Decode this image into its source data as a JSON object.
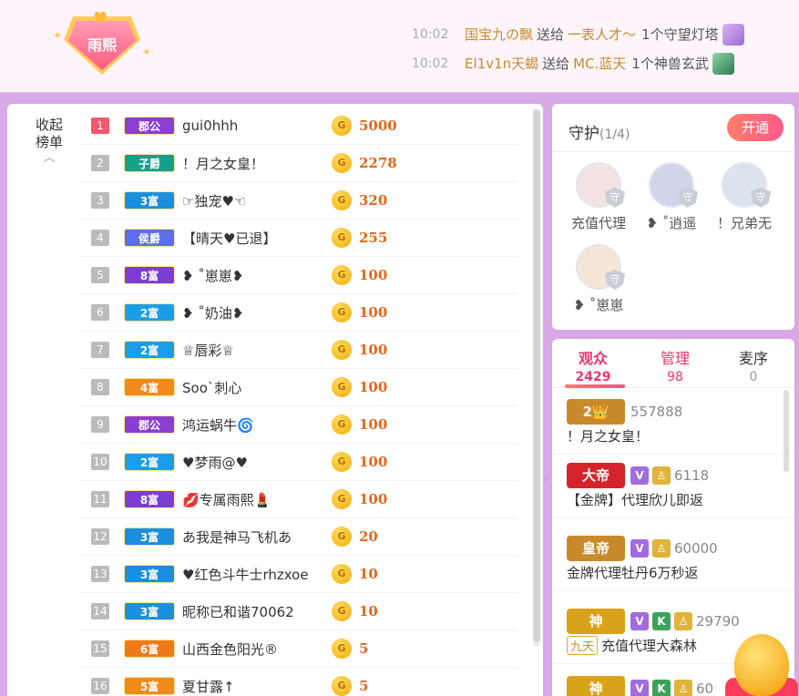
{
  "header": {
    "badge_label": "雨熙",
    "ticker": [
      {
        "time": "10:02",
        "sender": "国宝九の飘",
        "verb": "送给",
        "receiver": "一表人才～",
        "gift": "1个守望灯塔"
      },
      {
        "time": "10:02",
        "sender": "El1v1n天蝎",
        "verb": "送给",
        "receiver": "MC.蓝天",
        "gift": "1个神兽玄武"
      }
    ]
  },
  "ranking": {
    "collapse_label_1": "收起",
    "collapse_label_2": "榜单",
    "rows": [
      {
        "rank": "1",
        "level": "郡公",
        "level_color": "#8a3fd1",
        "name": "gui0hhh",
        "score": "5000"
      },
      {
        "rank": "2",
        "level": "子爵",
        "level_color": "#16a089",
        "name": "！月之女皇！",
        "score": "2278"
      },
      {
        "rank": "3",
        "level": "3富",
        "level_color": "#1a8fe0",
        "name": "☞独宠♥☜",
        "score": "320"
      },
      {
        "rank": "4",
        "level": "侯爵",
        "level_color": "#5a6fe8",
        "name": "【晴天♥已退】",
        "score": "255"
      },
      {
        "rank": "5",
        "level": "8富",
        "level_color": "#7c3cd8",
        "name": "❥ ˚崽崽❥",
        "score": "100"
      },
      {
        "rank": "6",
        "level": "2富",
        "level_color": "#1a9ee8",
        "name": "❥ ˚奶油❥",
        "score": "100"
      },
      {
        "rank": "7",
        "level": "2富",
        "level_color": "#1a9ee8",
        "name": "♕唇彩♕",
        "score": "100"
      },
      {
        "rank": "8",
        "level": "4富",
        "level_color": "#f08a1a",
        "name": "Soo`刺心",
        "score": "100"
      },
      {
        "rank": "9",
        "level": "郡公",
        "level_color": "#8a3fd1",
        "name": "鸿运蜗牛🌀",
        "score": "100"
      },
      {
        "rank": "10",
        "level": "2富",
        "level_color": "#1a9ee8",
        "name": "♥梦雨@♥",
        "score": "100"
      },
      {
        "rank": "11",
        "level": "8富",
        "level_color": "#7c3cd8",
        "name": "💋专属雨熙💄",
        "score": "100"
      },
      {
        "rank": "12",
        "level": "3富",
        "level_color": "#1a8fe0",
        "name": "あ我是神马飞机あ",
        "score": "20"
      },
      {
        "rank": "13",
        "level": "3富",
        "level_color": "#1a8fe0",
        "name": "♥红色斗牛士rhzxoe",
        "score": "10"
      },
      {
        "rank": "14",
        "level": "3富",
        "level_color": "#1a8fe0",
        "name": "昵称已和谐70062",
        "score": "10"
      },
      {
        "rank": "15",
        "level": "6富",
        "level_color": "#f07a1a",
        "name": "山西金色阳光®",
        "score": "5"
      },
      {
        "rank": "16",
        "level": "5富",
        "level_color": "#f08a1a",
        "name": "夏甘露↑",
        "score": "5"
      }
    ],
    "coin_glyph": "G"
  },
  "guard": {
    "title": "守护",
    "count": "(1/4)",
    "open_label": "开通",
    "shield_glyph": "守",
    "members": [
      {
        "name": "充值代理",
        "color": "#f3e3e3"
      },
      {
        "name": "❥ ˚逍遥",
        "color": "#cfd6ec"
      },
      {
        "name": "！兄弟无",
        "color": "#dbe3ee"
      },
      {
        "name": "❥ ˚崽崽",
        "color": "#f5e6d8"
      }
    ]
  },
  "audience": {
    "tabs": [
      {
        "label": "观众",
        "count": "2429"
      },
      {
        "label": "管理",
        "count": "98"
      },
      {
        "label": "麦序",
        "count": "0"
      }
    ],
    "entries": [
      {
        "badge": "2👑",
        "badge_color": "#c98a2b",
        "tags": [],
        "number": "557888",
        "name": "！月之女皇！"
      },
      {
        "badge": "大帝",
        "badge_color": "#d4242b",
        "tags": [
          "V",
          "♙"
        ],
        "number": "6118",
        "name": "【金牌】代理欣儿即返"
      },
      {
        "badge": "皇帝",
        "badge_color": "#c98a2b",
        "tags": [
          "V",
          "♙"
        ],
        "number": "60000",
        "name": "金牌代理牡丹6万秒返"
      },
      {
        "badge": "神",
        "badge_color": "#d9a21b",
        "tags": [
          "V",
          "K",
          "♙"
        ],
        "number": "29790",
        "name": "充值代理大森林",
        "prefix": "九天"
      },
      {
        "badge": "神",
        "badge_color": "#d9a21b",
        "tags": [
          "V",
          "K",
          "♙"
        ],
        "number": "60",
        "name": ""
      }
    ]
  }
}
